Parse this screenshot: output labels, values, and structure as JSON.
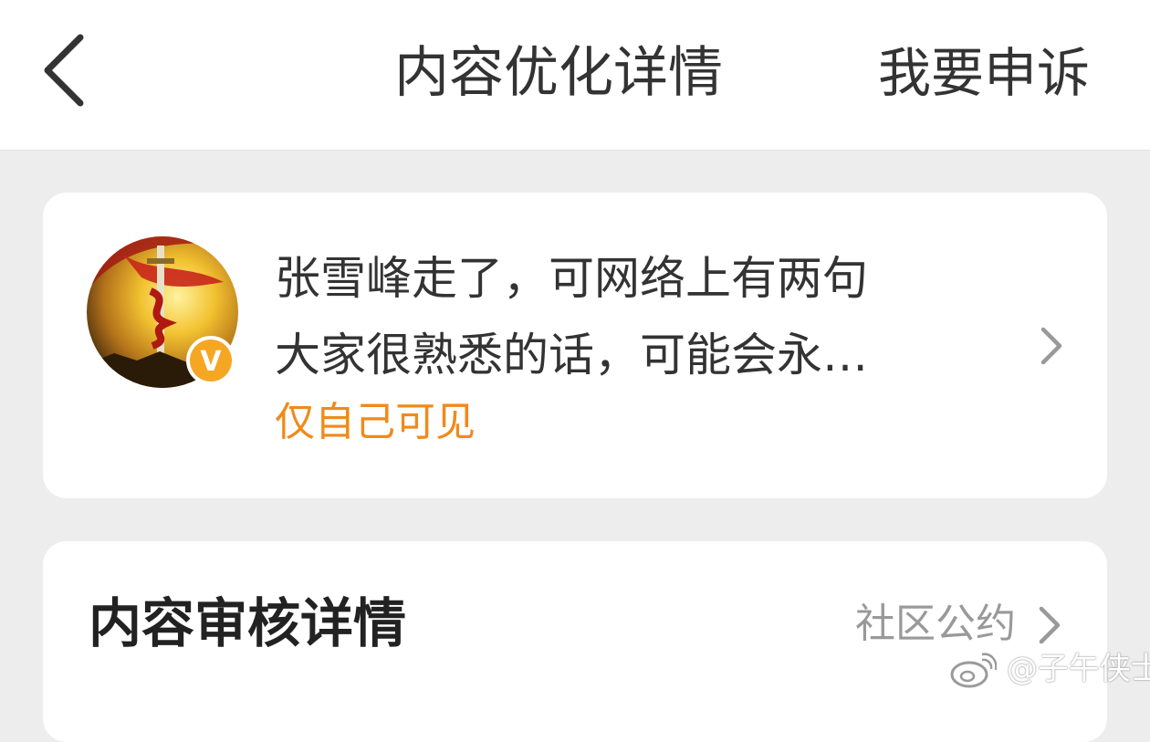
{
  "header": {
    "title": "内容优化详情",
    "appeal_label": "我要申诉"
  },
  "post": {
    "lines": [
      "张雪峰走了，可网络上有两句",
      "大家很熟悉的话，可能会永…"
    ],
    "visibility": "仅自己可见",
    "verified_badge": "V"
  },
  "review": {
    "title": "内容审核详情",
    "community_link": "社区公约"
  },
  "watermark": {
    "text": "@子午侠士"
  },
  "colors": {
    "visibility_orange": "#f08a1a",
    "badge_orange": "#f5a623",
    "page_bg": "#ededed"
  },
  "icons": [
    "back-arrow-icon",
    "chevron-right-icon",
    "verified-v-icon",
    "weibo-logo-icon"
  ]
}
